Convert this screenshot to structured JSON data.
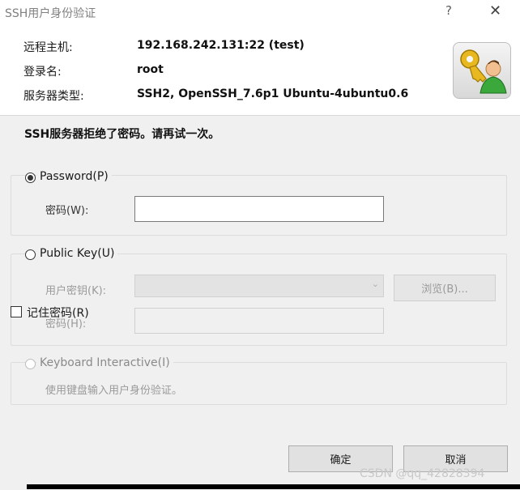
{
  "window": {
    "title": "SSH用户身份验证",
    "help": "?",
    "close": "✕"
  },
  "info": {
    "remote_host_label": "远程主机:",
    "remote_host_value": "192.168.242.131:22 (test)",
    "login_label": "登录名:",
    "login_value": "root",
    "server_type_label": "服务器类型:",
    "server_type_value": "SSH2, OpenSSH_7.6p1 Ubuntu-4ubuntu0.6"
  },
  "message": "SSH服务器拒绝了密码。请再试一次。",
  "password_group": {
    "label": "Password(P)",
    "selected": true,
    "field_label": "密码(W):",
    "value": ""
  },
  "publickey_group": {
    "label": "Public Key(U)",
    "selected": false,
    "user_key_label": "用户密钥(K):",
    "browse_label": "浏览(B)...",
    "passphrase_label": "密码(H):"
  },
  "keyboard_group": {
    "label": "Keyboard Interactive(I)",
    "selected": false,
    "description": "使用键盘输入用户身份验证。"
  },
  "remember": {
    "label": "记住密码(R)",
    "checked": false
  },
  "buttons": {
    "ok": "确定",
    "cancel": "取消"
  },
  "watermark": "CSDN @qq_42828394",
  "colors": {
    "panel_bg": "#f0f0f0",
    "button_bg": "#e1e1e1"
  }
}
